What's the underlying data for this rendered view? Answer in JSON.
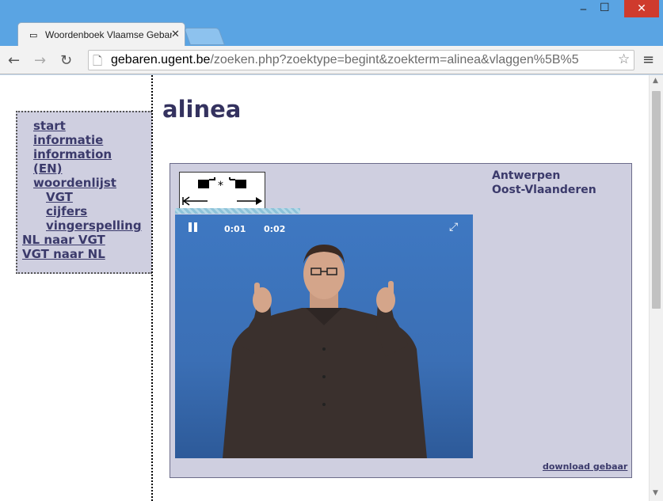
{
  "browser": {
    "tab_title": "Woordenboek Vlaamse Gebarentaal",
    "tab_icon": "window-icon",
    "url_domain": "gebaren.ugent.be",
    "url_path": "/zoeken.php?zoektype=begint&zoekterm=alinea&vlaggen%5B%5",
    "controls": {
      "minimize": "‒",
      "maximize": "☐",
      "close": "✕"
    }
  },
  "sidebar": {
    "items": [
      {
        "label": "start"
      },
      {
        "label": "informatie"
      },
      {
        "label": "information"
      },
      {
        "label": "(EN)"
      },
      {
        "label": "woordenlijst"
      },
      {
        "label": "VGT"
      },
      {
        "label": "cijfers"
      },
      {
        "label": "vingerspelling"
      },
      {
        "label": "NL naar VGT"
      },
      {
        "label": "VGT naar NL"
      }
    ]
  },
  "main": {
    "title": "alinea",
    "regions": [
      "Antwerpen",
      "Oost-Vlaanderen"
    ],
    "video": {
      "time_elapsed": "0:01",
      "time_total": "0:02"
    },
    "download_label": "download gebaar"
  },
  "colors": {
    "accent": "#34325f",
    "panel": "#cfcfe0",
    "titlebar": "#5aa4e3",
    "close": "#cf3b2d"
  }
}
